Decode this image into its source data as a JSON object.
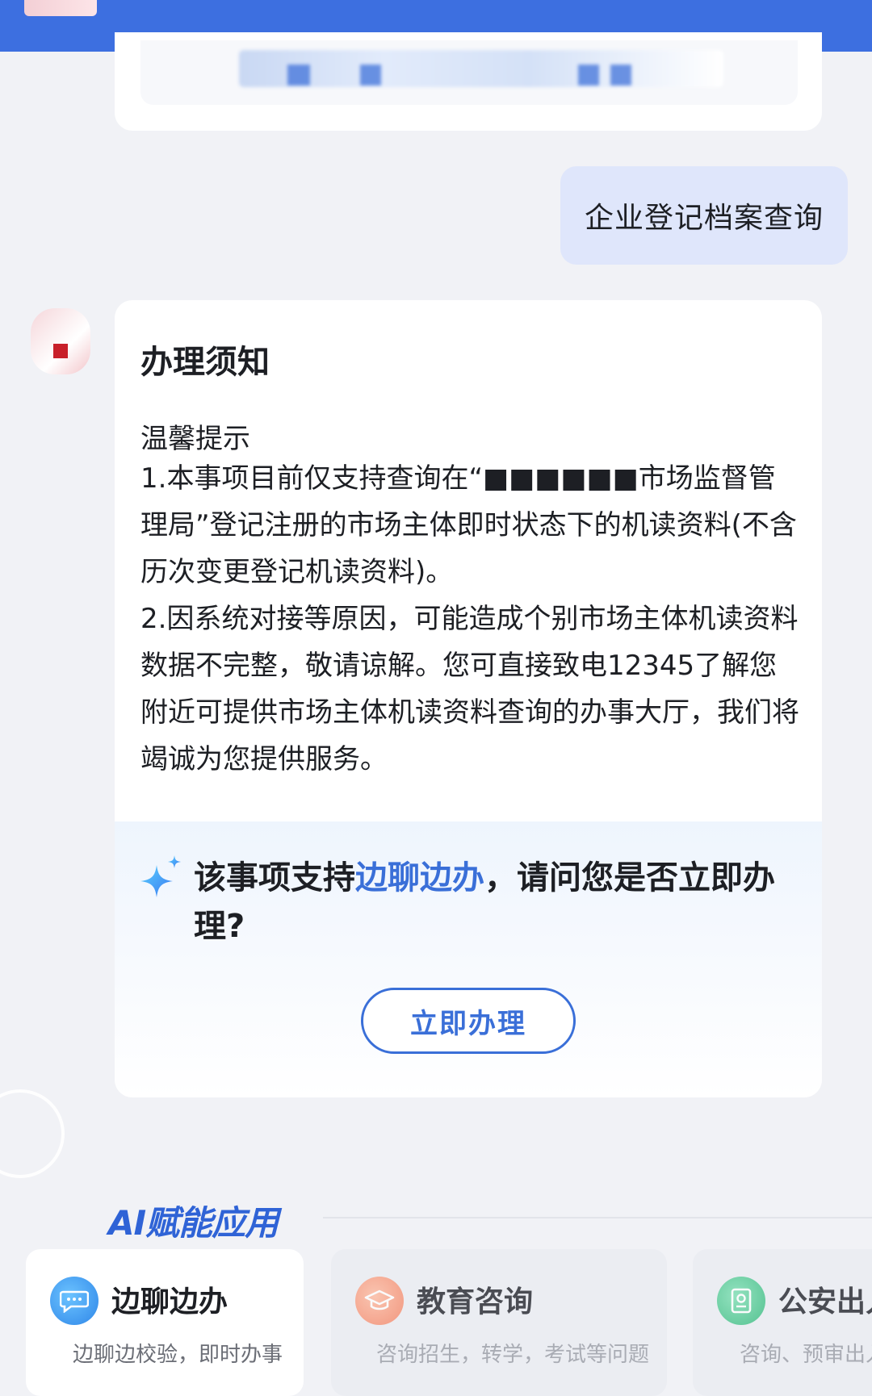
{
  "user_message": "企业登记档案查询",
  "card": {
    "title": "办理须知",
    "tip_heading": "温馨提示",
    "tip_lines": [
      "1.本事项目前仅支持查询在“■■■■■■市场监督管理局”登记注册的市场主体即时状态下的机读资料(不含历次变更登记机读资料)。",
      "2.因系统对接等原因，可能造成个别市场主体机读资料数据不完整，敬请谅解。您可直接致电12345了解您附近可提供市场主体机读资料查询的办事大厅，我们将竭诚为您提供服务。"
    ],
    "prompt_before": "该事项支持",
    "prompt_highlight": "边聊边办",
    "prompt_after": "，请问您是否立即办理?",
    "action_button": "立即办理"
  },
  "ai_section": {
    "title": "AI赋能应用",
    "tiles": [
      {
        "name": "边聊边办",
        "desc": "边聊边校验，即时办事",
        "icon": "chat-bubble-icon"
      },
      {
        "name": "教育咨询",
        "desc": "咨询招生，转学，考试等问题",
        "icon": "graduation-cap-icon"
      },
      {
        "name": "公安出入",
        "desc": "咨询、预审出入",
        "icon": "passport-icon"
      }
    ]
  },
  "colors": {
    "header_blue": "#3d6fe0",
    "accent_blue": "#3a6fd8",
    "user_bubble": "#dfe6fb",
    "background": "#f1f2f6"
  }
}
